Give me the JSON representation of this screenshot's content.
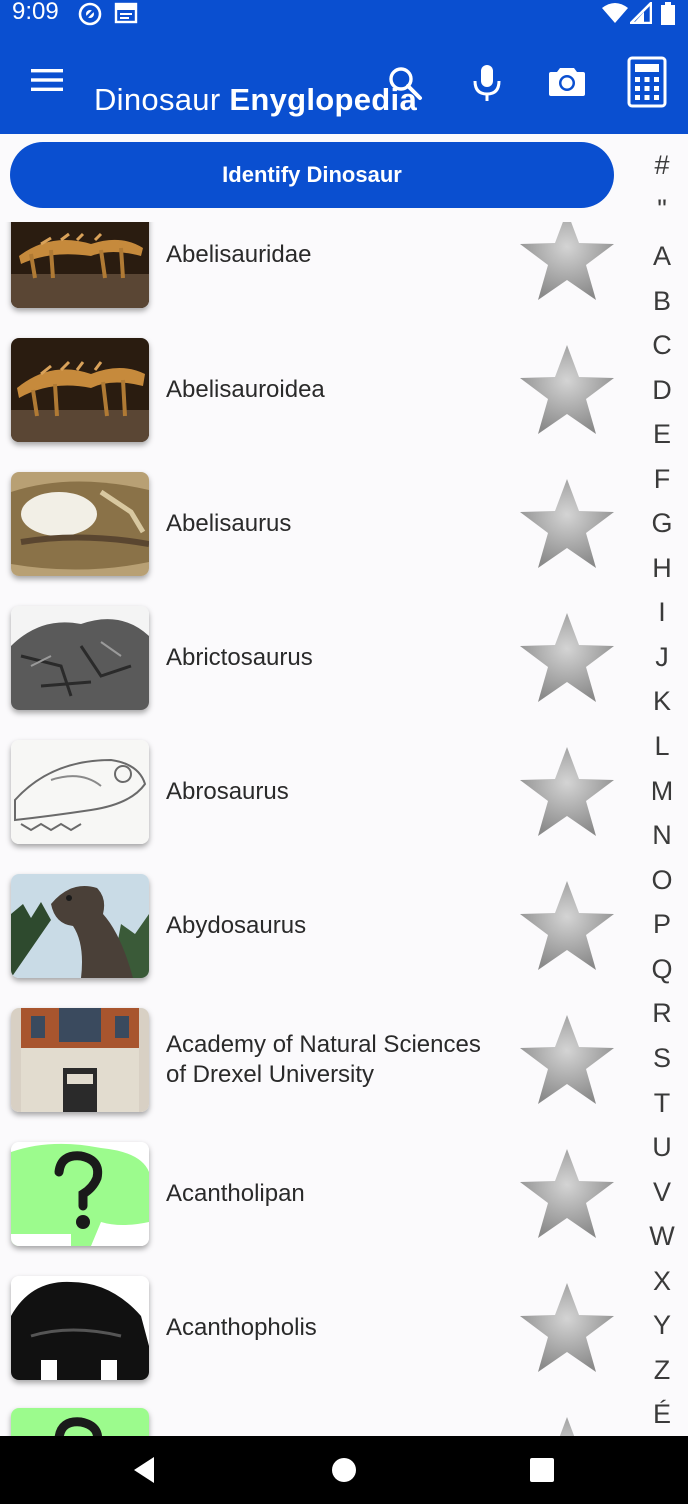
{
  "status_bar": {
    "time": "9:09",
    "icons": [
      "at-sign-icon",
      "sim-card-icon",
      "wifi-icon",
      "signal-icon",
      "battery-icon"
    ]
  },
  "app_bar": {
    "title_part1": "Dinosaur ",
    "title_part2": "Enyglopedia",
    "menu_icon": "menu-icon",
    "actions": [
      "search-icon",
      "microphone-icon",
      "camera-icon",
      "calculator-icon"
    ]
  },
  "identify_button": {
    "label": "Identify Dinosaur"
  },
  "list": {
    "items": [
      {
        "name": "Abelisauridae",
        "thumb": "skeleton-mount",
        "favorite_icon": "star-icon"
      },
      {
        "name": "Abelisauroidea",
        "thumb": "skeleton-mount",
        "favorite_icon": "star-icon"
      },
      {
        "name": "Abelisaurus",
        "thumb": "skull-fossil",
        "favorite_icon": "star-icon"
      },
      {
        "name": "Abrictosaurus",
        "thumb": "rock-fossil",
        "favorite_icon": "star-icon"
      },
      {
        "name": "Abrosaurus",
        "thumb": "skull-sketch",
        "favorite_icon": "star-icon"
      },
      {
        "name": "Abydosaurus",
        "thumb": "sauropod-head",
        "favorite_icon": "star-icon"
      },
      {
        "name": "Academy of Natural Sciences of Drexel University",
        "thumb": "museum-building",
        "favorite_icon": "star-icon"
      },
      {
        "name": "Acantholipan",
        "thumb": "placeholder-unknown",
        "favorite_icon": "star-icon"
      },
      {
        "name": "Acanthopholis",
        "thumb": "silhouette",
        "favorite_icon": "star-icon"
      },
      {
        "name": "",
        "thumb": "placeholder-unknown",
        "favorite_icon": "star-icon"
      }
    ]
  },
  "alphabet_index": [
    "#",
    "\"",
    "A",
    "B",
    "C",
    "D",
    "E",
    "F",
    "G",
    "H",
    "I",
    "J",
    "K",
    "L",
    "M",
    "N",
    "O",
    "P",
    "Q",
    "R",
    "S",
    "T",
    "U",
    "V",
    "W",
    "X",
    "Y",
    "Z",
    "É"
  ],
  "nav_bar": [
    "back-icon",
    "home-icon",
    "recents-icon"
  ],
  "colors": {
    "primary": "#0a4fd0",
    "placeholder_green": "#9cfb8d",
    "star_gray": "#a0a0a0"
  }
}
